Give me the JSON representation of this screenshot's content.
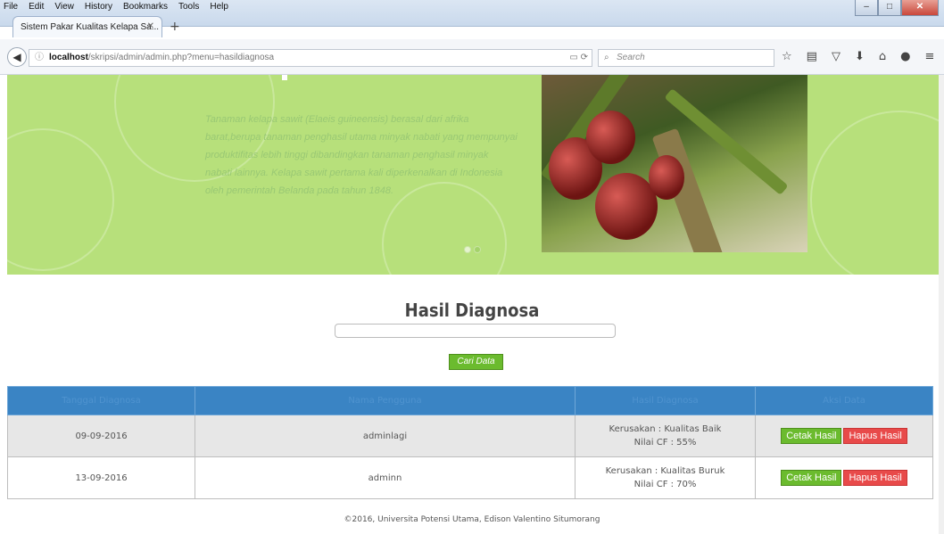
{
  "browser": {
    "menu": [
      "File",
      "Edit",
      "View",
      "History",
      "Bookmarks",
      "Tools",
      "Help"
    ],
    "tab_title": "Sistem Pakar Kualitas Kelapa Sa...",
    "url_host": "localhost",
    "url_path": "/skripsi/admin/admin.php?menu=hasildiagnosa",
    "search_placeholder": "Search"
  },
  "banner": {
    "text": "Tanaman kelapa sawit (Elaeis guineensis) berasal dari afrika barat,berupa tanaman penghasil utama minyak nabati yang mempunyai produktifitas lebih tinggi dibandingkan tanaman penghasil minyak nabati lainnya. Kelapa sawit pertama kali diperkenalkan di Indonesia oleh pemerintah Belanda pada tahun 1848."
  },
  "page": {
    "title": "Hasil Diagnosa",
    "search_value": "",
    "search_button": "Cari Data"
  },
  "table": {
    "headers": [
      "Tanggal Diagnosa",
      "Nama Pengguna",
      "Hasil Diagnosa",
      "Aksi Data"
    ],
    "rows": [
      {
        "date": "09-09-2016",
        "user": "adminlagi",
        "result": "Kerusakan : Kualitas Baik",
        "cf": "Nilai CF : 55%",
        "print": "Cetak Hasil",
        "delete": "Hapus Hasil"
      },
      {
        "date": "13-09-2016",
        "user": "adminn",
        "result": "Kerusakan : Kualitas Buruk",
        "cf": "Nilai CF : 70%",
        "print": "Cetak Hasil",
        "delete": "Hapus Hasil"
      }
    ]
  },
  "footer": "©2016, Universita Potensi Utama, Edison Valentino Situmorang"
}
